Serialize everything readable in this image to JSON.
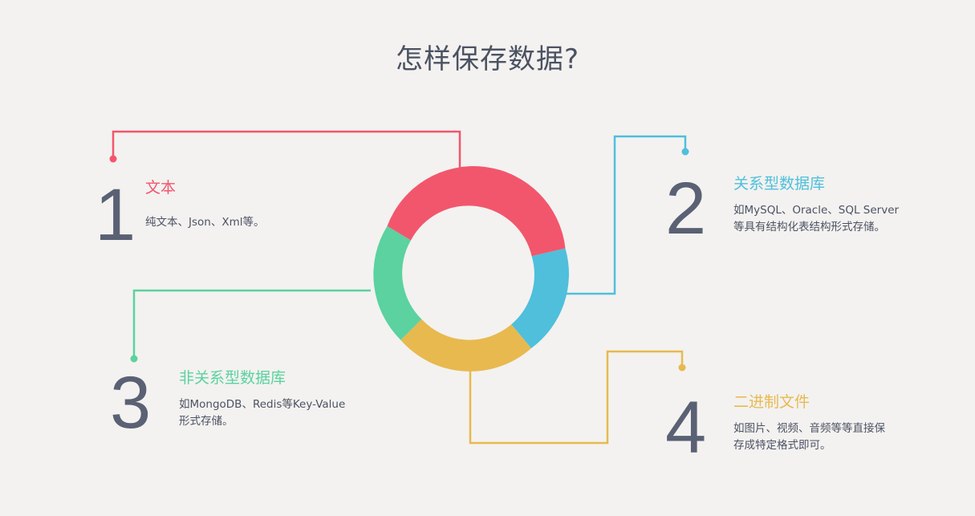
{
  "title": "怎样保存数据?",
  "colors": {
    "red": "#f2566d",
    "blue": "#4fbfdc",
    "yellow": "#e8b94f",
    "green": "#5bd29f",
    "number": "#5a6174"
  },
  "items": [
    {
      "number": "1",
      "heading": "文本",
      "desc": [
        "纯文本、Json、Xml等。"
      ]
    },
    {
      "number": "2",
      "heading": "关系型数据库",
      "desc": [
        "如MySQL、Oracle、SQL Server",
        "等具有结构化表结构形式存储。"
      ]
    },
    {
      "number": "3",
      "heading": "非关系型数据库",
      "desc": [
        "如MongoDB、Redis等Key-Value",
        "形式存储。"
      ]
    },
    {
      "number": "4",
      "heading": "二进制文件",
      "desc": [
        "如图片、视频、音频等等直接保",
        "存成特定格式即可。"
      ]
    }
  ],
  "ring": [
    {
      "label": "红色段",
      "start": 297,
      "end": 468
    },
    {
      "label": "蓝色段",
      "start": 468,
      "end": 545
    },
    {
      "label": "黄色段",
      "start": 545,
      "end": 640
    },
    {
      "label": "绿色段",
      "start": 640,
      "end": 657
    }
  ]
}
